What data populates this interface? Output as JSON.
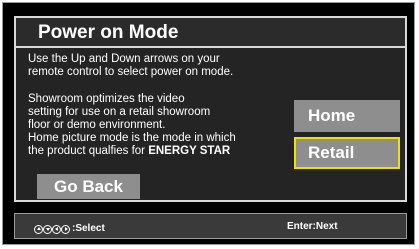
{
  "header": {
    "title": "Power on Mode"
  },
  "instructions": {
    "lines": [
      "Use the Up and Down arrows on your",
      "remote control to select power on mode."
    ]
  },
  "description": {
    "lines": [
      "Showroom optimizes the video",
      "setting for use on a retail showroom",
      "floor or demo environment.",
      "Home picture mode is the mode in which"
    ],
    "last_line_prefix": "the product qualfies for ",
    "last_line_bold": "ENERGY STAR"
  },
  "options": {
    "home_label": "Home",
    "retail_label": "Retail",
    "selected": "Retail",
    "highlight_color": "#f2e100"
  },
  "go_back_label": "Go Back",
  "footer": {
    "select_icons": [
      "arrow-up-icon",
      "arrow-down-icon",
      "arrow-left-icon",
      "arrow-right-icon"
    ],
    "select_text": ":Select",
    "enter_text": "Enter:Next"
  }
}
